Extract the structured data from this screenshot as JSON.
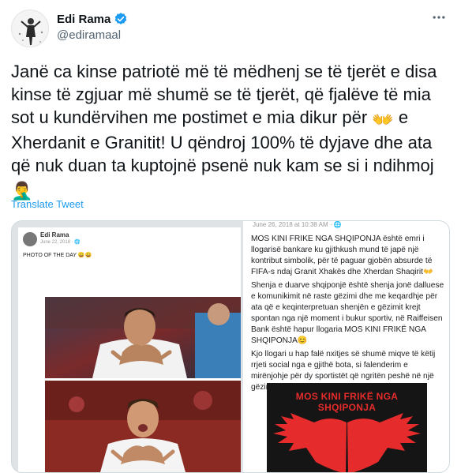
{
  "author": {
    "display_name": "Edi Rama",
    "handle": "@ediramaal",
    "verified": true,
    "avatar_icon": "profile-photo"
  },
  "more_icon": "more-options-icon",
  "tweet": {
    "text_part1": "Janë ca kinse patriotë më të mëdhenj se të tjerët e disa kinse të zgjuar më shumë se të tjerët, që fjalëve të mia sot u kundërvihen me postimet e mia dikur për ",
    "emoji1": "👐",
    "text_part2": " e Xherdanit e Granitit! U qëndroj 100% të dyjave dhe ata që nuk duan ta kuptojnë psenë nuk kam se si i ndihmoj ",
    "emoji2": "🤦‍♂️"
  },
  "translate_label": "Translate Tweet",
  "media": {
    "left_post": {
      "name": "Edi Rama",
      "date": "June 22, 2018 · 🌐",
      "caption": "PHOTO OF THE DAY 😀😀"
    },
    "right_post": {
      "date": "June 26, 2018 at 10:38 AM · 🌐",
      "paragraph1": "MOS KINI FRIKE NGA SHQIPONJA është emri i llogarisë bankare ku gjithkush mund të japë një kontribut simbolik, për të paguar gjobën absurde të FIFA-s ndaj Granit Xhakës dhe Xherdan Shaqirit👐",
      "paragraph2": "Shenja e duarve shqiponjë është shenja jonë dalluese e komunikimit në raste gëzimi dhe me keqardhje për ata që e keqinterpretuan shenjën e gëzimit krejt spontan nga një moment i bukur sportiv, në Raiffeisen Bank është hapur llogaria MOS KINI FRIKË NGA SHQIPONJA😊",
      "paragraph3": "Kjo llogari u hap falë nxitjes së shumë miqve të këtij rrjeti social nga e gjithë bota, si falenderim e mirënjohje për dy sportistët që ngritën peshë në një gëzim sportiv miliona shqiptarë🇦🇱🇽🇰",
      "banner_title": "MOS KINI FRIKË NGA SHQIPONJA"
    }
  },
  "colors": {
    "link": "#1d9bf0",
    "verified": "#1d9bf0",
    "banner_red": "#e52b2b"
  }
}
